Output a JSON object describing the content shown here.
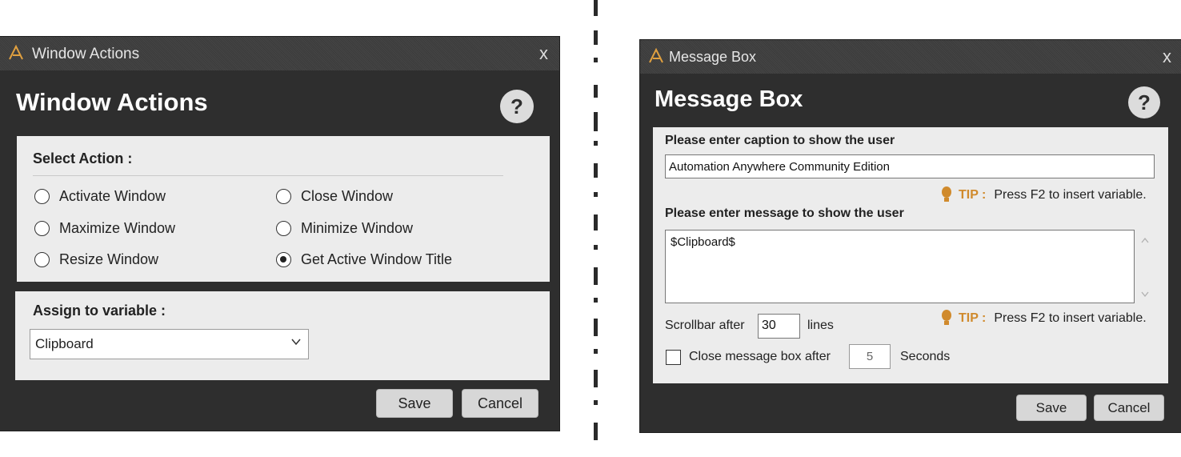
{
  "window_actions": {
    "title": "Window Actions",
    "heading": "Window Actions",
    "help": "?",
    "close": "x",
    "select_action_label": "Select Action :",
    "actions": [
      {
        "label": "Activate Window",
        "selected": false
      },
      {
        "label": "Close Window",
        "selected": false
      },
      {
        "label": "Maximize Window",
        "selected": false
      },
      {
        "label": "Minimize Window",
        "selected": false
      },
      {
        "label": "Resize Window",
        "selected": false
      },
      {
        "label": "Get Active Window Title",
        "selected": true
      }
    ],
    "assign_label": "Assign to variable :",
    "assign_value": "Clipboard",
    "save": "Save",
    "cancel": "Cancel"
  },
  "message_box": {
    "title": "Message Box",
    "heading": "Message Box",
    "help": "?",
    "close": "x",
    "caption_label": "Please enter caption to show the user",
    "caption_value": "Automation Anywhere Community Edition",
    "tip_word": "TIP :",
    "tip_text": "Press F2 to insert variable.",
    "message_label": "Please enter message to show the user",
    "message_value": "$Clipboard$",
    "scrollbar_prefix": "Scrollbar after",
    "scrollbar_value": "30",
    "scrollbar_suffix": "lines",
    "close_after_label": "Close message box after",
    "close_after_value": "5",
    "seconds_label": "Seconds",
    "close_after_checked": false,
    "save": "Save",
    "cancel": "Cancel"
  },
  "colors": {
    "dialog_bg": "#2e2e2e",
    "panel_bg": "#ececec",
    "tip_accent": "#d08a2c"
  }
}
